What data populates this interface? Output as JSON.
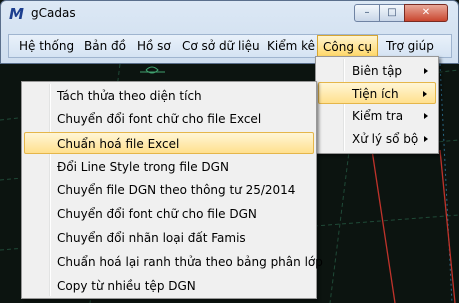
{
  "window": {
    "title": "gCadas",
    "logo_icon": "gcadas-logo-icon",
    "logo_text": "M",
    "controls": {
      "minimize": "–",
      "maximize": "□",
      "close": "✕"
    }
  },
  "menubar": {
    "items": [
      {
        "label": "Hệ thống"
      },
      {
        "label": "Bản đồ"
      },
      {
        "label": "Hồ sơ"
      },
      {
        "label": "Cơ sở dữ liệu"
      },
      {
        "label": "Kiểm kê"
      },
      {
        "label": "Công cụ",
        "active": true
      },
      {
        "label": "Trợ giúp"
      }
    ]
  },
  "cong_cu_menu": {
    "items": [
      {
        "label": "Biên tập",
        "submenu": true
      },
      {
        "label": "Tiện ích",
        "submenu": true,
        "highlighted": true
      },
      {
        "label": "Kiểm tra",
        "submenu": true
      },
      {
        "label": "Xử lý sổ bộ",
        "submenu": true
      }
    ]
  },
  "tien_ich_menu": {
    "items": [
      {
        "label": "Tách thửa theo diện tích"
      },
      {
        "label": "Chuyển đổi font chữ cho file Excel"
      },
      {
        "label": "Chuẩn hoá file Excel",
        "highlighted": true
      },
      {
        "label": "Đổi Line Style trong file DGN"
      },
      {
        "label": "Chuyển file DGN theo thông tư 25/2014"
      },
      {
        "label": "Chuyển đổi font chữ cho file DGN"
      },
      {
        "label": "Chuyển đổi nhãn loại đất Famis"
      },
      {
        "label": "Chuẩn hoá lại ranh thửa theo bảng phân lớp"
      },
      {
        "label": "Copy từ nhiều tệp DGN"
      }
    ]
  },
  "colors": {
    "cad_background": "#0c1410",
    "menu_highlight": "#ffe08e",
    "cad_red_line": "#c0332b",
    "cad_grid": "#1f4a37"
  }
}
